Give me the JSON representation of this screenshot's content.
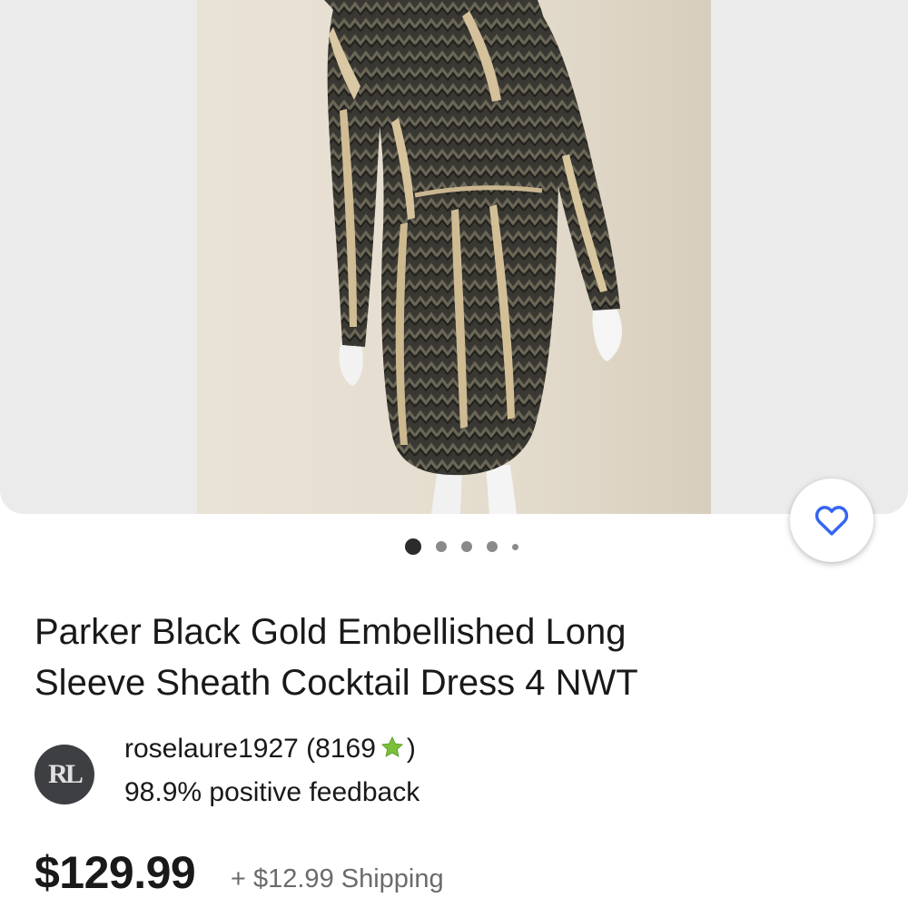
{
  "listing": {
    "title_line1": "Parker Black Gold Embellished Long",
    "title_line2": "Sleeve Sheath Cocktail Dress 4 NWT",
    "price": "$129.99",
    "shipping": "+ $12.99 Shipping"
  },
  "gallery": {
    "current_image": 1,
    "image_count": 5,
    "favorite_icon": "heart-outline-icon"
  },
  "seller": {
    "avatar_initials": "RL",
    "username": "roselaure1927",
    "feedback_score": "8169",
    "badge_icon": "green-star-icon",
    "feedback_percent": "98.9% positive feedback"
  },
  "colors": {
    "link_blue": "#3665f3",
    "star_green": "#7bbf3a",
    "shipping_gray": "#6b6b6b",
    "gallery_bg": "#ebebeb"
  }
}
